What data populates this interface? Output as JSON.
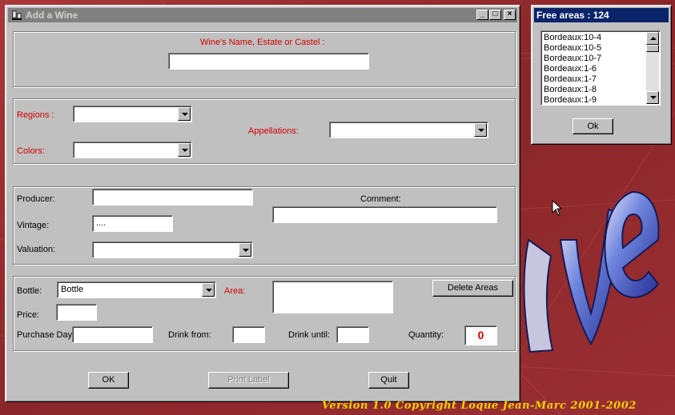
{
  "window": {
    "title": "Add a Wine",
    "minimize_glyph": "_",
    "maximize_glyph": "□",
    "close_glyph": "×"
  },
  "name_section": {
    "label": "Wine's Name, Estate or Castel :",
    "value": ""
  },
  "region_section": {
    "regions_label": "Regions :",
    "regions_value": "",
    "colors_label": "Colors:",
    "colors_value": "",
    "appellations_label": "Appellations:",
    "appellations_value": ""
  },
  "details_section": {
    "producer_label": "Producer:",
    "producer_value": "",
    "vintage_label": "Vintage:",
    "vintage_value": "....",
    "valuation_label": "Valuation:",
    "valuation_value": "",
    "comment_label": "Comment:",
    "comment_value": ""
  },
  "bottle_section": {
    "bottle_label": "Bottle:",
    "bottle_value": "Bottle",
    "area_label": "Area:",
    "area_value": "",
    "delete_areas_label": "Delete Areas",
    "price_label": "Price:",
    "price_value": "",
    "purchase_day_label": "Purchase Day:",
    "purchase_day_value": "",
    "drink_from_label": "Drink from:",
    "drink_from_value": "",
    "drink_until_label": "Drink until:",
    "drink_until_value": "",
    "quantity_label": "Quantity:",
    "quantity_value": "0"
  },
  "footer": {
    "ok_label": "OK",
    "print_label": "Print Label",
    "quit_label": "Quit"
  },
  "free_areas": {
    "title": "Free areas : 124",
    "items": [
      "Bordeaux:10-4",
      "Bordeaux:10-5",
      "Bordeaux:10-7",
      "Bordeaux:1-6",
      "Bordeaux:1-7",
      "Bordeaux:1-8",
      "Bordeaux:1-9"
    ],
    "ok_label": "Ok"
  },
  "desktop": {
    "copyright": "Version 1.0 Copyright Loque Jean-Marc 2001-2002"
  },
  "colors": {
    "title_active": "#0a246a",
    "title_inactive": "#808080",
    "label_red": "#d40000",
    "quantity_red": "#d40000",
    "desktop_bg": "#8e2a2e",
    "copyright_yellow": "#f3d000"
  }
}
